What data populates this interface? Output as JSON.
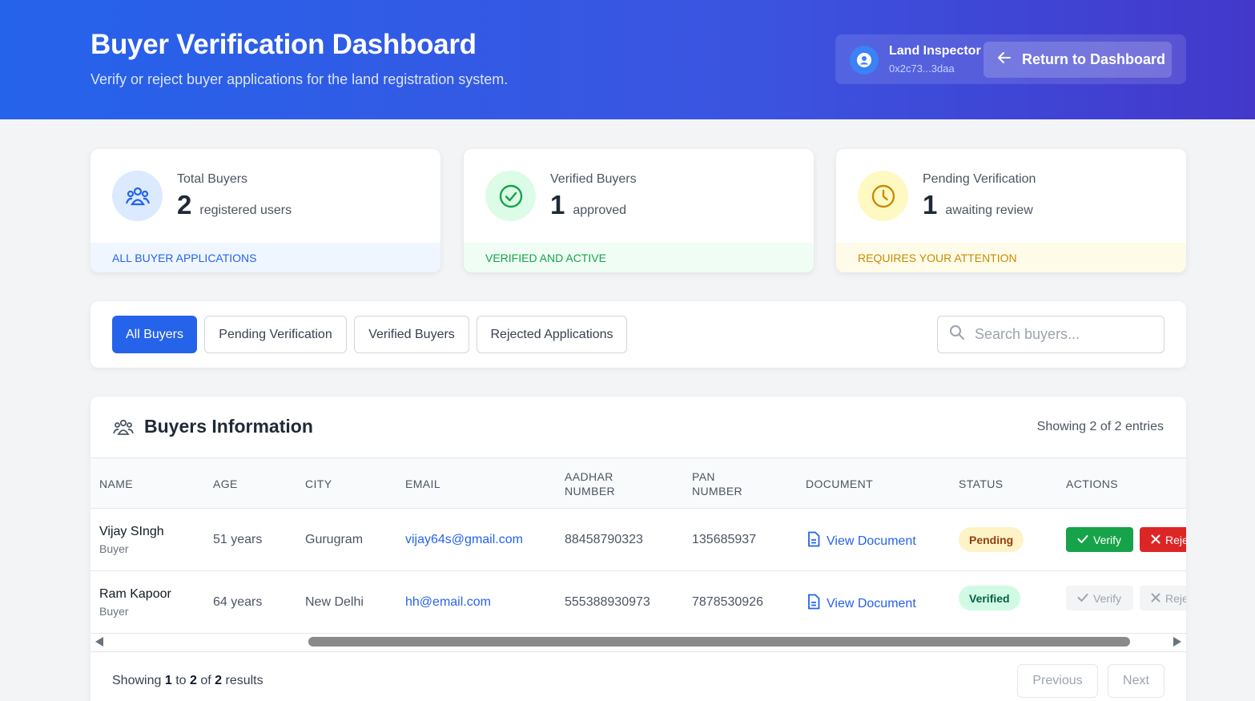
{
  "header": {
    "title": "Buyer Verification Dashboard",
    "subtitle": "Verify or reject buyer applications for the land registration system.",
    "user_role": "Land Inspector",
    "user_address": "0x2c73...3daa",
    "return_label": "Return to Dashboard"
  },
  "stats": [
    {
      "label": "Total Buyers",
      "value": "2",
      "unit": "registered users",
      "footer": "ALL BUYER APPLICATIONS",
      "icon": "users-icon",
      "color": "#2563eb"
    },
    {
      "label": "Verified Buyers",
      "value": "1",
      "unit": "approved",
      "footer": "VERIFIED AND ACTIVE",
      "icon": "check-circle-icon",
      "color": "#16a34a"
    },
    {
      "label": "Pending Verification",
      "value": "1",
      "unit": "awaiting review",
      "footer": "REQUIRES YOUR ATTENTION",
      "icon": "clock-icon",
      "color": "#ca8a04"
    }
  ],
  "tabs": [
    "All Buyers",
    "Pending Verification",
    "Verified Buyers",
    "Rejected Applications"
  ],
  "active_tab": "All Buyers",
  "search": {
    "placeholder": "Search buyers...",
    "value": ""
  },
  "table": {
    "title": "Buyers Information",
    "count_text": "Showing 2 of 2 entries",
    "columns": [
      "NAME",
      "AGE",
      "CITY",
      "EMAIL",
      "AADHAR NUMBER",
      "PAN NUMBER",
      "DOCUMENT",
      "STATUS",
      "ACTIONS"
    ],
    "rows": [
      {
        "name": "Vijay SIngh",
        "role": "Buyer",
        "age": "51 years",
        "city": "Gurugram",
        "email": "vijay64s@gmail.com",
        "aadhar": "88458790323",
        "pan": "135685937",
        "document": "View Document",
        "status": "Pending",
        "verify": "Verify",
        "reject": "Reject"
      },
      {
        "name": "Ram Kapoor",
        "role": "Buyer",
        "age": "64 years",
        "city": "New Delhi",
        "email": "hh@email.com",
        "aadhar": "555388930973",
        "pan": "7878530926",
        "document": "View Document",
        "status": "Verified",
        "verify": "Verify",
        "reject": "Reject"
      }
    ]
  },
  "pagination": {
    "prefix": "Showing",
    "from": "1",
    "to_word": "to",
    "to": "2",
    "of_word": "of",
    "total": "2",
    "suffix": "results",
    "previous": "Previous",
    "next": "Next"
  }
}
